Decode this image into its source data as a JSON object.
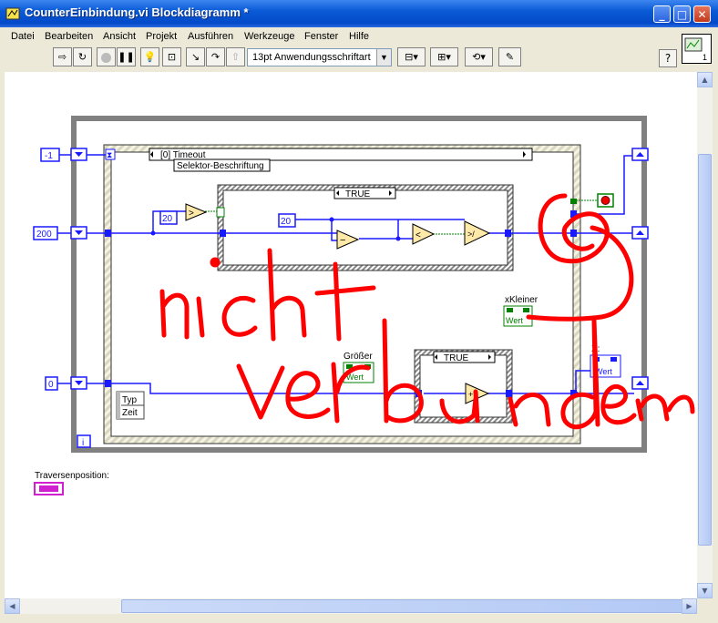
{
  "window": {
    "title": "CounterEinbindung.vi Blockdiagramm *"
  },
  "menu": [
    "Datei",
    "Bearbeiten",
    "Ansicht",
    "Projekt",
    "Ausführen",
    "Werkzeuge",
    "Fenster",
    "Hilfe"
  ],
  "toolbar": {
    "font": "13pt Anwendungsschriftart",
    "help": "?"
  },
  "diagram": {
    "const_neg1": "-1",
    "const_200": "200",
    "const_0": "0",
    "case_timeout": "[0] Timeout",
    "selector_label": "Selektor-Beschriftung",
    "case_true_1": "TRUE",
    "case_true_2": "TRUE",
    "const_20a": "20",
    "const_20b": "20",
    "xkleiner_label": "xKleiner",
    "groesser_label": "Größer",
    "x_label": "X:",
    "wert": "Wert",
    "typ": "Typ",
    "zeit": "Zeit",
    "plus1": "+1",
    "iteration": "i",
    "traversen_label": "Traversenposition:"
  },
  "annotation": {
    "handwritten_1": "nicht",
    "handwritten_2": "verbunden"
  },
  "colors": {
    "wire_blue": "#1a1aff",
    "wire_green": "#008000",
    "ink_red": "#ff0000",
    "title_blue": "#0a5ad6"
  }
}
